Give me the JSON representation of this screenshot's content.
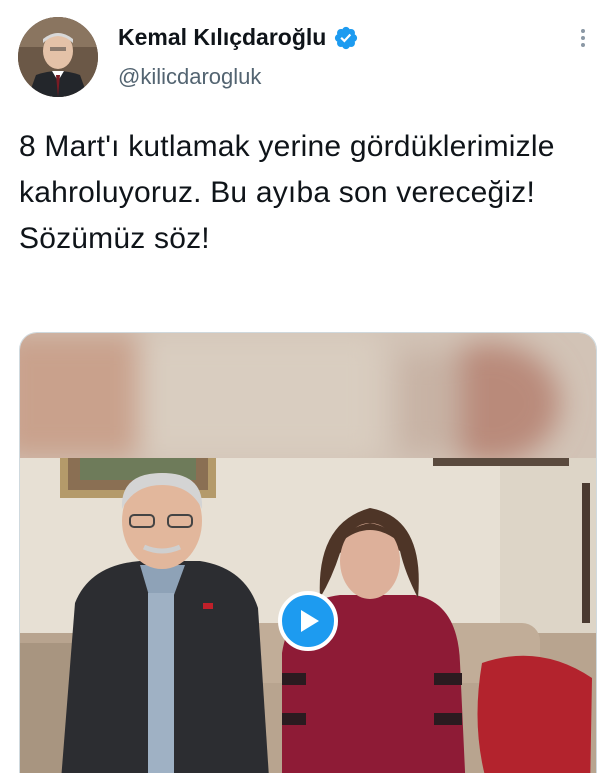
{
  "author": {
    "display_name": "Kemal Kılıçdaroğlu",
    "handle": "@kilicdarogluk",
    "verified_icon": "verified-badge-icon",
    "avatar_icon": "avatar"
  },
  "tweet": {
    "text": "8 Mart'ı kutlamak yerine gördüklerimizle kahroluyoruz. Bu ayıba son vereceğiz! Sözümüz söz!"
  },
  "media": {
    "type": "video",
    "play_icon": "play-icon"
  },
  "colors": {
    "accent": "#1d9bf0",
    "text_primary": "#0f1419",
    "text_secondary": "#536471"
  },
  "menu": {
    "icon": "more-options-icon"
  }
}
